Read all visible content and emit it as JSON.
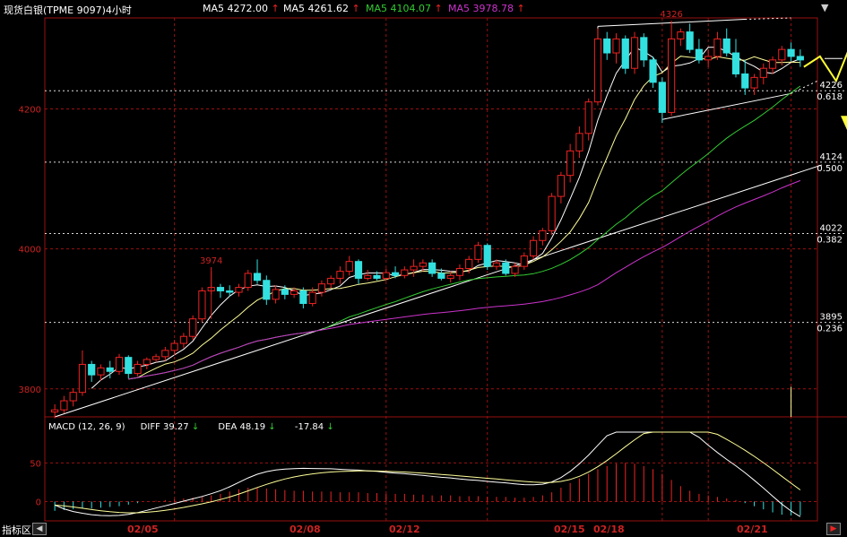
{
  "header": {
    "title": "现货白银(TPME 9097)4小时",
    "ma_items": [
      {
        "label": "MA5 4272.00",
        "arrow": "↑",
        "color": "#ffffff"
      },
      {
        "label": "MA5 4261.62",
        "arrow": "↑",
        "color": "#ffffff"
      },
      {
        "label": "MA5 4104.07",
        "arrow": "↑",
        "color": "#33cc33"
      },
      {
        "label": "MA5 3978.78",
        "arrow": "↑",
        "color": "#cc33cc"
      }
    ]
  },
  "macd_header": {
    "label": "MACD (12, 26, 9)",
    "diff_label": "DIFF",
    "diff_value": "39.27",
    "diff_arrow": "↓",
    "dea_label": "DEA",
    "dea_value": "48.19",
    "dea_arrow": "↓",
    "macd_value": "-17.84",
    "macd_arrow": "↓"
  },
  "footer": {
    "indicator_tab": "指标区",
    "dates": [
      "02/05",
      "02/08",
      "02/12",
      "02/15",
      "02/18",
      "02/21"
    ]
  },
  "colors": {
    "up": "#ee2222",
    "down": "#33e0e0",
    "grid": "#991111",
    "axis_text": "#cc2222",
    "ma1": "#ffffff",
    "ma2": "#ffff99",
    "ma3": "#33cc33",
    "ma4": "#cc33cc",
    "trend": "#ffffff",
    "projection": "#ffff33"
  },
  "chart_data": {
    "type": "candlestick",
    "title": "现货白银(TPME 9097)4小时",
    "y_range": [
      3760,
      4330
    ],
    "macd_range": [
      -25,
      90
    ],
    "y_ticks": [
      3800,
      4000,
      4200
    ],
    "macd_ticks": [
      0,
      50
    ],
    "fib_levels": [
      {
        "price": 4226,
        "label": "4226",
        "ratio": "0.618"
      },
      {
        "price": 4124,
        "label": "4124",
        "ratio": "0.500"
      },
      {
        "price": 4022,
        "label": "4022",
        "ratio": "0.382"
      },
      {
        "price": 3895,
        "label": "3895",
        "ratio": "0.236"
      }
    ],
    "annotations": [
      {
        "text": "3974",
        "price": 3974,
        "index": 17
      },
      {
        "text": "4326",
        "price": 4326,
        "index": 67
      }
    ],
    "candles": [
      [
        3767,
        3778,
        3758,
        3770
      ],
      [
        3770,
        3790,
        3765,
        3783
      ],
      [
        3783,
        3800,
        3775,
        3795
      ],
      [
        3795,
        3855,
        3790,
        3835
      ],
      [
        3835,
        3840,
        3810,
        3820
      ],
      [
        3820,
        3835,
        3812,
        3830
      ],
      [
        3830,
        3840,
        3815,
        3825
      ],
      [
        3825,
        3850,
        3820,
        3845
      ],
      [
        3845,
        3848,
        3815,
        3822
      ],
      [
        3822,
        3840,
        3818,
        3835
      ],
      [
        3835,
        3845,
        3828,
        3842
      ],
      [
        3842,
        3850,
        3838,
        3846
      ],
      [
        3846,
        3860,
        3840,
        3855
      ],
      [
        3855,
        3870,
        3848,
        3865
      ],
      [
        3865,
        3880,
        3858,
        3875
      ],
      [
        3875,
        3905,
        3870,
        3900
      ],
      [
        3900,
        3945,
        3895,
        3940
      ],
      [
        3940,
        3974,
        3935,
        3945
      ],
      [
        3945,
        3950,
        3930,
        3940
      ],
      [
        3940,
        3948,
        3932,
        3938
      ],
      [
        3938,
        3950,
        3932,
        3945
      ],
      [
        3945,
        3970,
        3940,
        3965
      ],
      [
        3965,
        3985,
        3950,
        3955
      ],
      [
        3955,
        3962,
        3920,
        3928
      ],
      [
        3928,
        3948,
        3922,
        3942
      ],
      [
        3942,
        3948,
        3928,
        3935
      ],
      [
        3935,
        3945,
        3930,
        3940
      ],
      [
        3940,
        3945,
        3915,
        3922
      ],
      [
        3922,
        3945,
        3918,
        3938
      ],
      [
        3938,
        3955,
        3932,
        3950
      ],
      [
        3950,
        3962,
        3944,
        3958
      ],
      [
        3958,
        3975,
        3950,
        3968
      ],
      [
        3968,
        3990,
        3962,
        3982
      ],
      [
        3982,
        3985,
        3950,
        3958
      ],
      [
        3958,
        3970,
        3955,
        3962
      ],
      [
        3962,
        3968,
        3955,
        3958
      ],
      [
        3958,
        3972,
        3954,
        3966
      ],
      [
        3966,
        3975,
        3958,
        3962
      ],
      [
        3962,
        3975,
        3958,
        3970
      ],
      [
        3970,
        3985,
        3960,
        3975
      ],
      [
        3975,
        3985,
        3968,
        3980
      ],
      [
        3980,
        3985,
        3960,
        3965
      ],
      [
        3965,
        3972,
        3955,
        3958
      ],
      [
        3958,
        3968,
        3952,
        3962
      ],
      [
        3962,
        3978,
        3955,
        3972
      ],
      [
        3972,
        3990,
        3965,
        3985
      ],
      [
        3985,
        4010,
        3980,
        4005
      ],
      [
        4005,
        4008,
        3970,
        3975
      ],
      [
        3975,
        3985,
        3970,
        3980
      ],
      [
        3980,
        3985,
        3962,
        3965
      ],
      [
        3965,
        3980,
        3960,
        3975
      ],
      [
        3975,
        3995,
        3970,
        3990
      ],
      [
        3990,
        4018,
        3985,
        4012
      ],
      [
        4012,
        4030,
        4005,
        4026
      ],
      [
        4026,
        4080,
        4020,
        4075
      ],
      [
        4075,
        4110,
        4065,
        4105
      ],
      [
        4105,
        4150,
        4095,
        4140
      ],
      [
        4140,
        4175,
        4130,
        4165
      ],
      [
        4165,
        4215,
        4155,
        4210
      ],
      [
        4210,
        4315,
        4205,
        4300
      ],
      [
        4300,
        4310,
        4270,
        4280
      ],
      [
        4280,
        4308,
        4265,
        4300
      ],
      [
        4300,
        4305,
        4250,
        4258
      ],
      [
        4258,
        4310,
        4250,
        4302
      ],
      [
        4302,
        4308,
        4260,
        4270
      ],
      [
        4270,
        4275,
        4230,
        4238
      ],
      [
        4238,
        4245,
        4180,
        4195
      ],
      [
        4195,
        4326,
        4190,
        4300
      ],
      [
        4300,
        4315,
        4290,
        4310
      ],
      [
        4310,
        4322,
        4280,
        4285
      ],
      [
        4285,
        4300,
        4265,
        4270
      ],
      [
        4270,
        4285,
        4260,
        4275
      ],
      [
        4275,
        4310,
        4270,
        4300
      ],
      [
        4300,
        4315,
        4275,
        4280
      ],
      [
        4280,
        4300,
        4245,
        4250
      ],
      [
        4250,
        4270,
        4220,
        4230
      ],
      [
        4230,
        4250,
        4220,
        4245
      ],
      [
        4245,
        4265,
        4235,
        4258
      ],
      [
        4258,
        4275,
        4250,
        4270
      ],
      [
        4270,
        4290,
        4262,
        4285
      ],
      [
        4285,
        4295,
        4268,
        4275
      ],
      [
        4275,
        4285,
        4260,
        4270
      ]
    ],
    "macd_bars": [
      -12,
      -11,
      -10,
      -9,
      -9,
      -8,
      -7,
      -6,
      -4,
      -2,
      0,
      1,
      2,
      3,
      4,
      5,
      6,
      8,
      10,
      13,
      16,
      18,
      18,
      17,
      16,
      15,
      14,
      14,
      13,
      13,
      13,
      12,
      12,
      12,
      11,
      11,
      10,
      10,
      10,
      9,
      9,
      8,
      8,
      8,
      7,
      7,
      7,
      6,
      6,
      6,
      5,
      5,
      6,
      8,
      12,
      18,
      24,
      30,
      36,
      42,
      46,
      49,
      50,
      49,
      46,
      42,
      36,
      28,
      20,
      14,
      10,
      8,
      6,
      4,
      2,
      -2,
      -6,
      -10,
      -14,
      -17,
      -18,
      -18
    ]
  }
}
